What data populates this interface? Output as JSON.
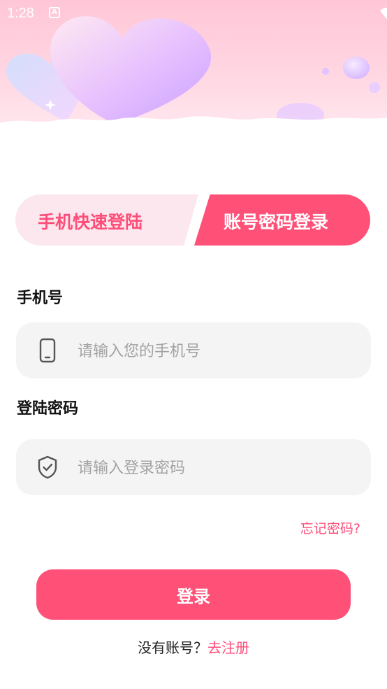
{
  "status_bar": {
    "time": "1:28",
    "icons": [
      "accessibility-icon",
      "wifi-icon",
      "signal-icon",
      "battery-icon"
    ]
  },
  "tabs": [
    {
      "label": "手机快速登陆",
      "active": false
    },
    {
      "label": "账号密码登录",
      "active": true
    }
  ],
  "phone": {
    "label": "手机号",
    "placeholder": "请输入您的手机号",
    "icon": "phone-icon"
  },
  "password": {
    "label": "登陆密码",
    "placeholder": "请输入登录密码",
    "icon": "shield-icon"
  },
  "forgot_label": "忘记密码?",
  "login_label": "登录",
  "register": {
    "prompt": "没有账号？",
    "link": "去注册"
  },
  "colors": {
    "accent": "#ff5078",
    "accent_text": "#ff4d79",
    "tab_inactive_bg": "#fde7ee",
    "input_bg": "#f4f4f4"
  }
}
